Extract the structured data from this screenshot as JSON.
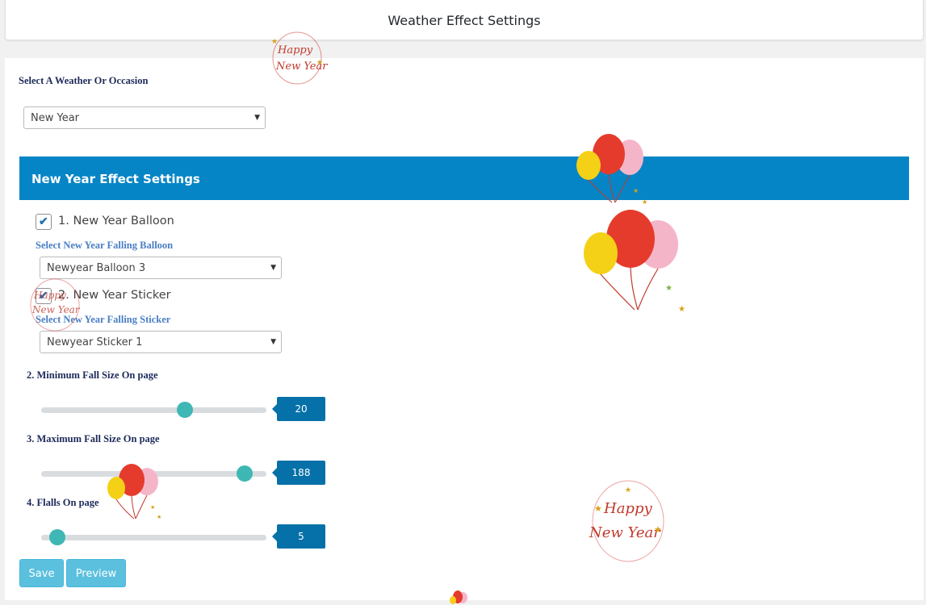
{
  "page": {
    "title": "Weather Effect Settings"
  },
  "occasion": {
    "label": "Select A Weather Or Occasion",
    "selected": "New Year"
  },
  "section": {
    "title": "New Year Effect Settings"
  },
  "balloon": {
    "checkbox_label": "1. New Year Balloon",
    "checked": true,
    "select_label": "Select New Year Falling Balloon",
    "selected": "Newyear Balloon 3"
  },
  "sticker": {
    "checkbox_label": "2. New Year Sticker",
    "checked": true,
    "select_label": "Select New Year Falling Sticker",
    "selected": "Newyear Sticker 1"
  },
  "sliders": {
    "min_size": {
      "label": "2. Minimum Fall Size On page",
      "value": "20",
      "fraction": 0.64
    },
    "max_size": {
      "label": "3. Maximum Fall Size On page",
      "value": "188",
      "fraction": 0.91
    },
    "falls": {
      "label": "4. Flalls On page",
      "value": "5",
      "fraction": 0.07
    }
  },
  "buttons": {
    "save": "Save",
    "preview": "Preview"
  },
  "decorations": {
    "sticker_text_1": "Happy",
    "sticker_text_2": "New Year"
  },
  "colors": {
    "accent": "#0685c6",
    "slider_thumb": "#3fb7b4",
    "value_box": "#0571a8",
    "button": "#5bc0de"
  }
}
